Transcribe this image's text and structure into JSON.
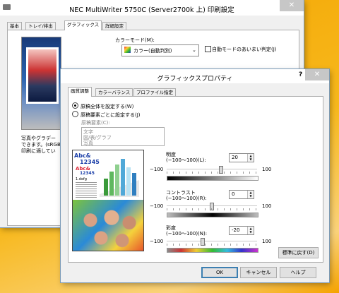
{
  "printer_window": {
    "title": "NEC MultiWriter 5750C (Server2700k 上) 印刷設定",
    "close_label": "✕",
    "tabs": [
      "基本",
      "トレイ/排出",
      "グラフィックス",
      "詳細設定"
    ],
    "color_mode_label": "カラーモード(M):",
    "color_mode_value": "カラー(自動判別)",
    "auto_mode_check_label": "自動モードのあいまい判定(J)",
    "desc_text": [
      "写真やグラデー",
      "できます。(sRGB",
      "印刷に適してい"
    ]
  },
  "gfx_dialog": {
    "title": "グラフィックスプロパティ",
    "help_label": "?",
    "close_label": "✕",
    "tabs": [
      "画質調整",
      "カラーバランス",
      "プロファイル指定"
    ],
    "radio_all_label": "原稿全体を設定する(W)",
    "radio_each_label": "原稿要素ごとに設定する(J)",
    "elements_label": "原稿要素(C):",
    "elements": [
      "文字",
      "図/表/グラフ",
      "写真"
    ],
    "brightness": {
      "label1": "明度",
      "label2": "(−100〜100)(L):",
      "value": "20",
      "min": "−100",
      "max": "100",
      "level": 0.6
    },
    "contrast": {
      "label1": "コントラスト",
      "label2": "(−100〜100)(R):",
      "value": "0",
      "min": "−100",
      "max": "100",
      "level": 0.5
    },
    "saturation": {
      "label1": "彩度",
      "label2": "(−100〜100)(N):",
      "value": "-20",
      "min": "−100",
      "max": "100",
      "level": 0.4
    },
    "reset_label": "標準に戻す(D)",
    "ok_label": "OK",
    "cancel_label": "キャンセル",
    "help_btn_label": "ヘルプ",
    "preview": {
      "abc1": "Abc&",
      "n1": "12345",
      "abc2": "Abc&",
      "n2": "12345",
      "small": "1.defg"
    }
  },
  "colors": {
    "accent": "#3c7fb1",
    "window_bg": "#f0f0f0"
  }
}
